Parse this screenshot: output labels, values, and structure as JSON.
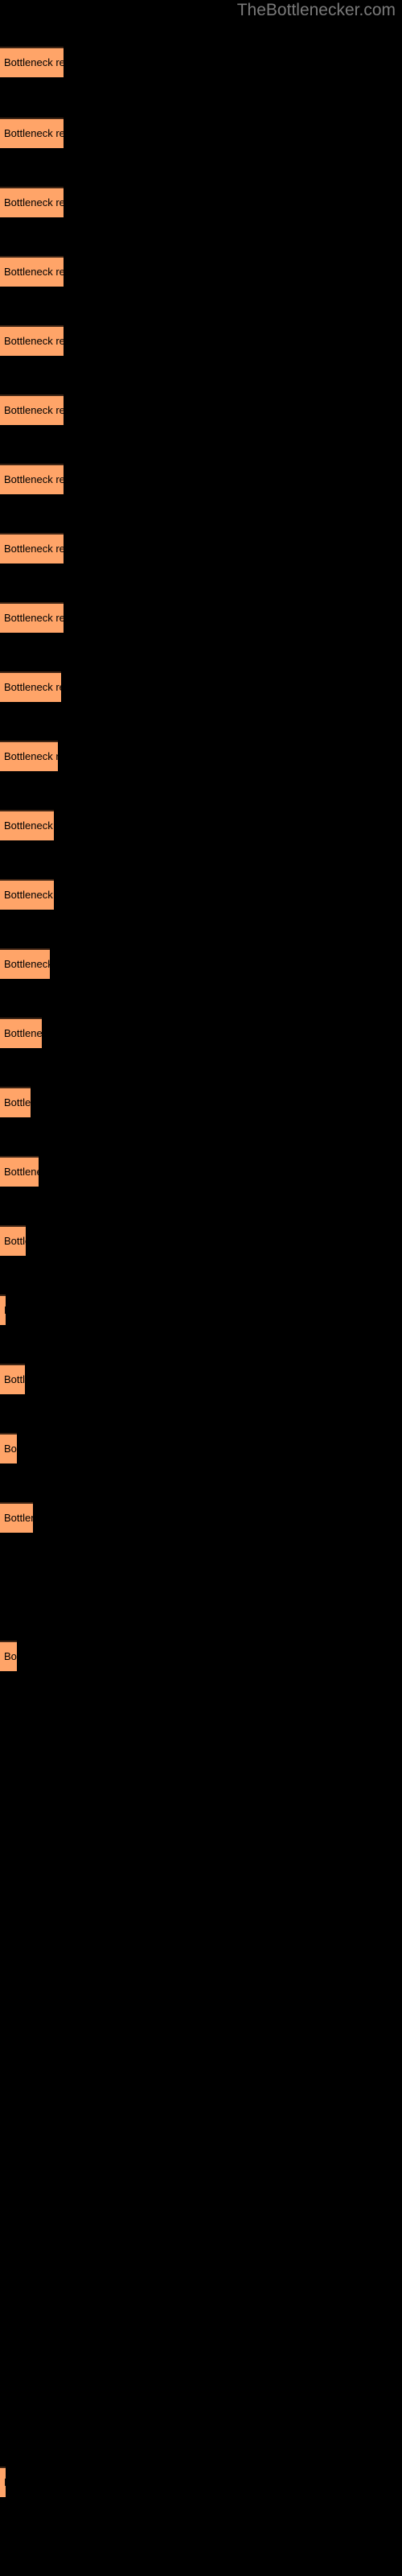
{
  "site": {
    "title": "TheBottlenecker.com",
    "title_color": "#7a7a7a"
  },
  "theme": {
    "background": "#000000",
    "bar_fill": "#ffa468",
    "bar_border": "#3d2414",
    "label_color": "#000000"
  },
  "chart_data": {
    "type": "bar",
    "orientation": "horizontal",
    "title": "TheBottlenecker.com",
    "xlabel": "",
    "ylabel": "",
    "grid": false,
    "legend": false,
    "bar_label_text": "Bottleneck result",
    "xlim": [
      0,
      500
    ],
    "categories": [
      "Bottleneck result",
      "Bottleneck result",
      "Bottleneck result",
      "Bottleneck result",
      "Bottleneck result",
      "Bottleneck result",
      "Bottleneck result",
      "Bottleneck result",
      "Bottleneck result",
      "Bottleneck result",
      "Bottleneck result",
      "Bottleneck result",
      "Bottleneck result",
      "Bottleneck result",
      "Bottleneck result",
      "Bottleneck result",
      "Bottleneck result",
      "Bottleneck result",
      "Bottleneck result",
      "Bottleneck result",
      "Bottleneck result",
      "Bottleneck result",
      "Bottleneck result",
      "Bottleneck result"
    ],
    "values": [
      79,
      79,
      79,
      79,
      79,
      79,
      79,
      79,
      79,
      76,
      72,
      67,
      67,
      62,
      52,
      38,
      48,
      32,
      7,
      31,
      21,
      41,
      0,
      21
    ],
    "bars": [
      {
        "y": 58,
        "width": 79,
        "label": "Bottleneck result"
      },
      {
        "y": 146,
        "width": 79,
        "label": "Bottleneck result"
      },
      {
        "y": 232,
        "width": 79,
        "label": "Bottleneck result"
      },
      {
        "y": 318,
        "width": 79,
        "label": "Bottleneck result"
      },
      {
        "y": 404,
        "width": 79,
        "label": "Bottleneck result"
      },
      {
        "y": 490,
        "width": 79,
        "label": "Bottleneck result"
      },
      {
        "y": 576,
        "width": 79,
        "label": "Bottleneck result"
      },
      {
        "y": 662,
        "width": 79,
        "label": "Bottleneck result"
      },
      {
        "y": 748,
        "width": 79,
        "label": "Bottleneck result"
      },
      {
        "y": 834,
        "width": 76,
        "label": "Bottleneck result"
      },
      {
        "y": 920,
        "width": 72,
        "label": "Bottleneck result"
      },
      {
        "y": 1006,
        "width": 67,
        "label": "Bottleneck result"
      },
      {
        "y": 1092,
        "width": 67,
        "label": "Bottleneck result"
      },
      {
        "y": 1178,
        "width": 62,
        "label": "Bottleneck result"
      },
      {
        "y": 1264,
        "width": 52,
        "label": "Bottleneck result"
      },
      {
        "y": 1350,
        "width": 38,
        "label": "Bottleneck result"
      },
      {
        "y": 1436,
        "width": 48,
        "label": "Bottleneck result"
      },
      {
        "y": 1522,
        "width": 32,
        "label": "Bottleneck result"
      },
      {
        "y": 1608,
        "width": 7,
        "label": "Bottleneck result"
      },
      {
        "y": 1694,
        "width": 31,
        "label": "Bottleneck result"
      },
      {
        "y": 1780,
        "width": 21,
        "label": "Bottleneck result"
      },
      {
        "y": 1866,
        "width": 41,
        "label": "Bottleneck result"
      },
      {
        "y": 2038,
        "width": 21,
        "label": "Bottleneck result"
      },
      {
        "y": 3064,
        "width": 7,
        "label": "Bottleneck result"
      }
    ]
  }
}
